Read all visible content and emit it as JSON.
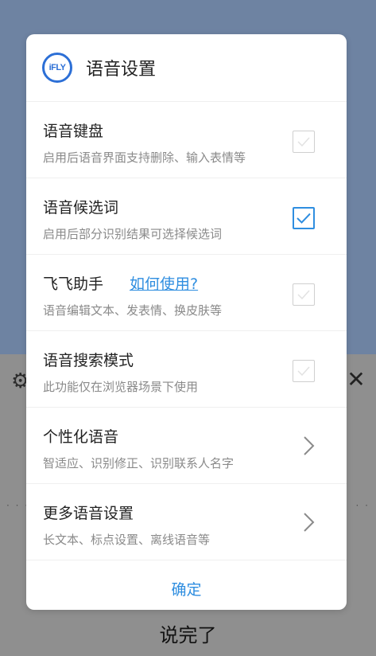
{
  "dialog": {
    "logo_text": "iFLY",
    "title": "语音设置",
    "rows": [
      {
        "title": "语音键盘",
        "desc": "启用后语音界面支持删除、输入表情等",
        "checked": false
      },
      {
        "title": "语音候选词",
        "desc": "启用后部分识别结果可选择候选词",
        "checked": true
      },
      {
        "title": "飞飞助手",
        "link": "如何使用?",
        "desc": "语音编辑文本、发表情、换皮肤等",
        "checked": false
      },
      {
        "title": "语音搜索模式",
        "desc": "此功能仅在浏览器场景下使用",
        "checked": false
      },
      {
        "title": "个性化语音",
        "desc": "智适应、识别修正、识别联系人名字"
      },
      {
        "title": "更多语音设置",
        "desc": "长文本、标点设置、离线语音等"
      }
    ],
    "confirm": "确定"
  },
  "background": {
    "done_label": "说完了",
    "close_symbol": "✕",
    "gear_symbol": "⚙"
  },
  "colors": {
    "accent": "#2f8ee0",
    "logo": "#2c6fd6"
  }
}
